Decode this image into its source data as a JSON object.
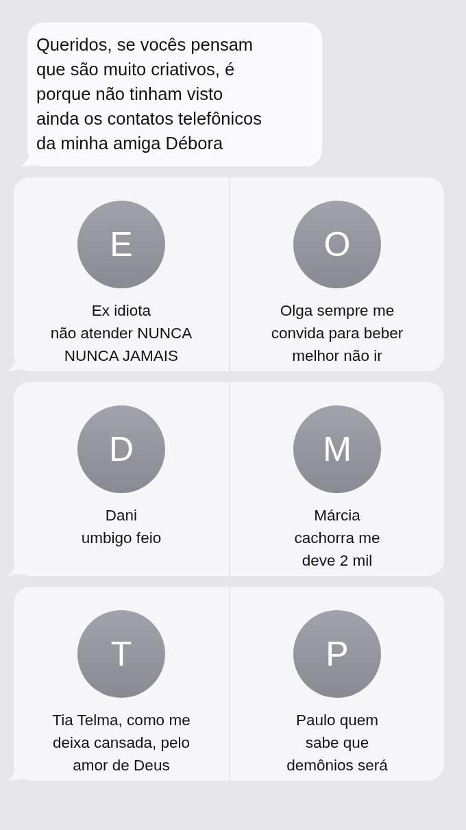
{
  "message": {
    "lines": [
      "Queridos, se vocês pensam",
      "que são muito criativos, é",
      "porque não tinham visto",
      "ainda os contatos telefônicos",
      "da minha amiga Débora"
    ]
  },
  "cards": [
    {
      "contacts": [
        {
          "initial": "E",
          "lines": [
            "Ex idiota",
            "não atender NUNCA",
            "NUNCA JAMAIS"
          ]
        },
        {
          "initial": "O",
          "lines": [
            "Olga sempre me",
            "convida para beber",
            "melhor não ir"
          ]
        }
      ]
    },
    {
      "contacts": [
        {
          "initial": "D",
          "lines": [
            "Dani",
            "umbigo feio"
          ]
        },
        {
          "initial": "M",
          "lines": [
            "Márcia",
            "cachorra me",
            "deve 2 mil"
          ]
        }
      ]
    },
    {
      "contacts": [
        {
          "initial": "T",
          "lines": [
            "Tia Telma, como me",
            "deixa cansada, pelo",
            "amor de Deus"
          ]
        },
        {
          "initial": "P",
          "lines": [
            "Paulo quem",
            "sabe que",
            "demônios será"
          ]
        }
      ]
    }
  ]
}
